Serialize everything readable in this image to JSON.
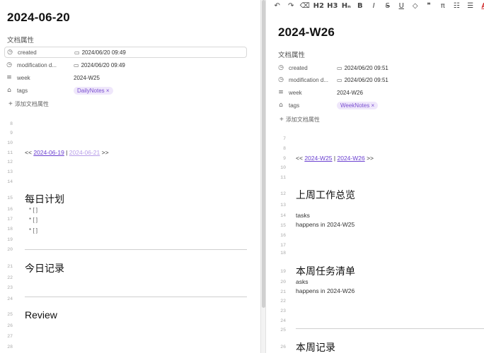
{
  "left": {
    "title": "2024-06-20",
    "attr_heading": "文档属性",
    "attrs": [
      {
        "icon": "clock-icon",
        "name": "created",
        "value": "2024/06/20 09:49"
      },
      {
        "icon": "clock-icon",
        "name": "modification d...",
        "value": "2024/06/20 09:49"
      },
      {
        "icon": "text-lines-icon",
        "name": "week",
        "value": "2024-W25"
      },
      {
        "icon": "tag-icon",
        "name": "tags",
        "value": "DailyNotes"
      }
    ],
    "add_attr": "添加文档属性",
    "line_numbers": [
      "8",
      "9",
      "10",
      "11",
      "12",
      "13",
      "14",
      "15",
      "16",
      "17",
      "18",
      "19",
      "20",
      "21",
      "22",
      "23",
      "24",
      "25",
      "26",
      "27",
      "28"
    ],
    "nav": {
      "prefix": "<<",
      "prev": "2024-06-19",
      "sep": "|",
      "next": "2024-06-21",
      "suffix": ">>"
    },
    "h_plan": "每日计划",
    "tasks": [
      "* [ ]",
      "* [ ]",
      "* [ ]"
    ],
    "h_record": "今日记录",
    "h_review": "Review"
  },
  "right": {
    "toolbar": [
      "↶",
      "↷",
      "⌫",
      "H2",
      "H3",
      "Hₙ",
      "B",
      "I",
      "S",
      "U",
      "◇",
      "❞",
      "π",
      "☷",
      "☰",
      "A"
    ],
    "title": "2024-W26",
    "attr_heading": "文档属性",
    "attrs": [
      {
        "icon": "clock-icon",
        "name": "created",
        "value": "2024/06/20 09:51"
      },
      {
        "icon": "clock-icon",
        "name": "modification d...",
        "value": "2024/06/20 09:51"
      },
      {
        "icon": "text-lines-icon",
        "name": "week",
        "value": "2024-W26"
      },
      {
        "icon": "tag-icon",
        "name": "tags",
        "value": "WeekNotes"
      }
    ],
    "add_attr": "添加文档属性",
    "line_numbers": [
      "7",
      "8",
      "9",
      "10",
      "11",
      "12",
      "13",
      "14",
      "15",
      "16",
      "17",
      "18",
      "19",
      "20",
      "21",
      "22",
      "23",
      "24",
      "25",
      "26"
    ],
    "nav": {
      "prefix": "<<",
      "prev": "2024-W25",
      "sep": "|",
      "next": "2024-W26",
      "suffix": ">>"
    },
    "h_last_week": "上周工作总览",
    "tasks_word": "tasks",
    "happens_w25": "happens in 2024-W25",
    "h_this_week": "本周任务清单",
    "asks_word": "asks",
    "happens_w26": "happens in 2024-W26",
    "h_week_record": "本周记录"
  },
  "colors": {
    "accent": "#7a4fd0",
    "link": "#6a3fd0",
    "tag_bg": "#efe7fb",
    "font_color_button": "#d43a3a"
  }
}
